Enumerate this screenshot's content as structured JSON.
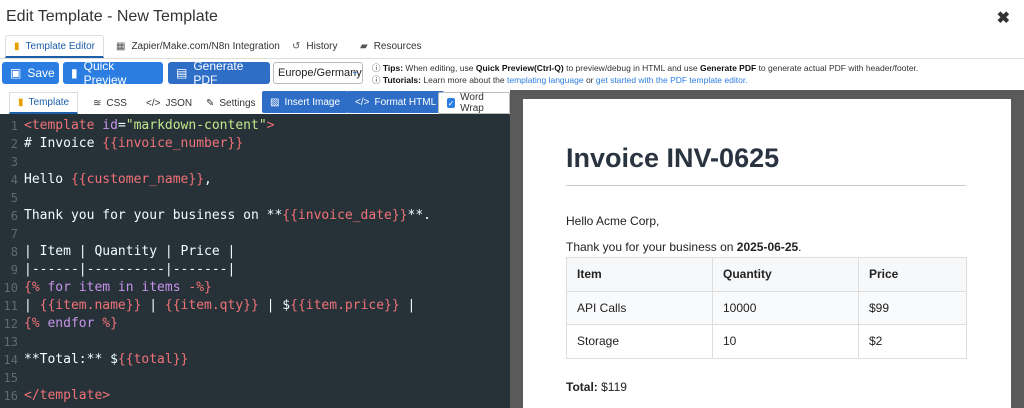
{
  "window": {
    "title": "Edit Template - New Template"
  },
  "tabs": [
    {
      "label": "Template Editor",
      "icon": "paint-bucket-icon",
      "active": true
    },
    {
      "label": "Zapier/Make.com/N8n Integration",
      "icon": "table-icon"
    },
    {
      "label": "History",
      "icon": "history-icon"
    },
    {
      "label": "Resources",
      "icon": "book-icon"
    }
  ],
  "toolbar": {
    "save_label": "Save",
    "quick_preview_label": "Quick Preview",
    "generate_pdf_label": "Generate PDF",
    "locale_value": "Europe/Germany"
  },
  "tips": {
    "tips_label": "Tips:",
    "tips_text_1": "When editing, use",
    "tips_bold_1": "Quick Preview(Ctrl-Q)",
    "tips_text_2": "to preview/debug in HTML and use",
    "tips_bold_2": "Generate PDF",
    "tips_text_3": "to generate actual PDF with header/footer.",
    "tutorials_label": "Tutorials:",
    "tutorials_text_1": "Learn more about the",
    "tutorials_link_1": "templating language",
    "tutorials_text_2": "or",
    "tutorials_link_2": "get started with the PDF template editor."
  },
  "subtabs": {
    "template": "Template",
    "css": "CSS",
    "json": "JSON",
    "settings": "Settings",
    "insert_image": "Insert Image",
    "format_html": "Format HTML",
    "word_wrap": "Word Wrap"
  },
  "editor": {
    "line_numbers": [
      "1",
      "2",
      "3",
      "4",
      "5",
      "6",
      "7",
      "8",
      "9",
      "10",
      "11",
      "12",
      "13",
      "14",
      "15",
      "16"
    ]
  },
  "preview": {
    "heading": "Invoice INV-0625",
    "greeting": "Hello Acme Corp,",
    "thanks_prefix": "Thank you for your business on",
    "thanks_date": "2025-06-25",
    "thanks_suffix": ".",
    "table_headers": [
      "Item",
      "Quantity",
      "Price"
    ],
    "rows": [
      [
        "API Calls",
        "10000",
        "$99"
      ],
      [
        "Storage",
        "10",
        "$2"
      ]
    ],
    "total_label": "Total:",
    "total_value": "$119"
  }
}
